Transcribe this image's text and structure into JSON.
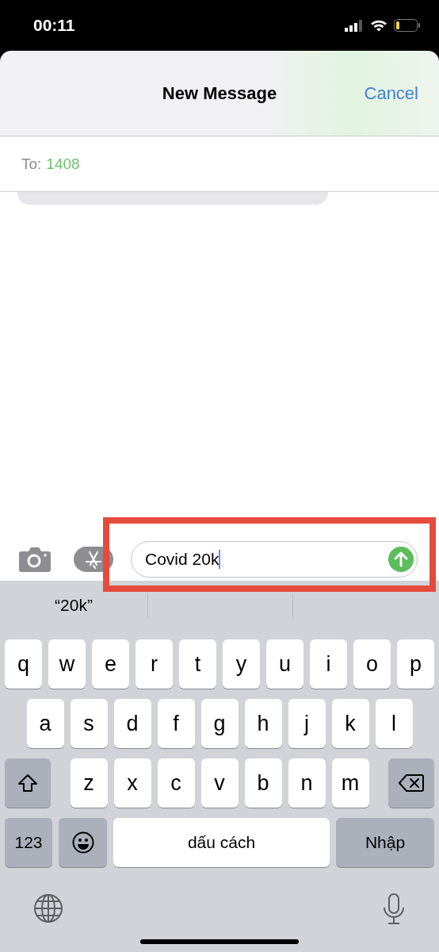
{
  "status_bar": {
    "time": "00:11"
  },
  "header": {
    "title": "New Message",
    "cancel": "Cancel"
  },
  "recipient": {
    "label": "To:",
    "value": "1408"
  },
  "compose": {
    "value": "Covid 20k"
  },
  "suggestions": [
    "“20k”"
  ],
  "keyboard": {
    "rows": [
      [
        "q",
        "w",
        "e",
        "r",
        "t",
        "y",
        "u",
        "i",
        "o",
        "p"
      ],
      [
        "a",
        "s",
        "d",
        "f",
        "g",
        "h",
        "j",
        "k",
        "l"
      ],
      [
        "z",
        "x",
        "c",
        "v",
        "b",
        "n",
        "m"
      ]
    ],
    "numbers": "123",
    "space": "dấu cách",
    "return": "Nhập"
  }
}
